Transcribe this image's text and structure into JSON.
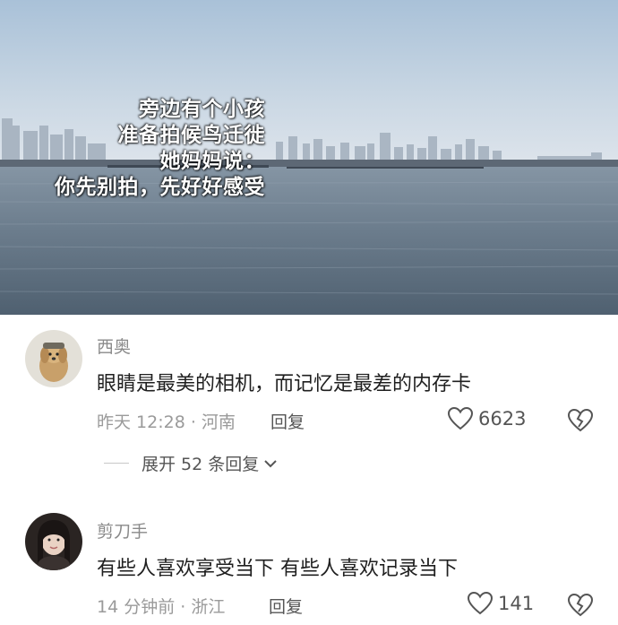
{
  "photo": {
    "caption_lines": [
      "旁边有个小孩",
      "准备拍候鸟迁徙",
      "她妈妈说：",
      "你先别拍，先好好感受"
    ]
  },
  "comments": [
    {
      "username": "西奥",
      "text": "眼睛是最美的相机，而记忆是最差的内存卡",
      "time_location": "昨天 12:28 · 河南",
      "reply_label": "回复",
      "likes": "6623",
      "avatar_icon": "dog-avatar"
    },
    {
      "username": "剪刀手",
      "text": "有些人喜欢享受当下 有些人喜欢记录当下",
      "time_location": "14 分钟前 · 浙江",
      "reply_label": "回复",
      "likes": "141",
      "avatar_icon": "girl-avatar"
    }
  ],
  "expand_replies": {
    "label": "展开 52 条回复"
  }
}
